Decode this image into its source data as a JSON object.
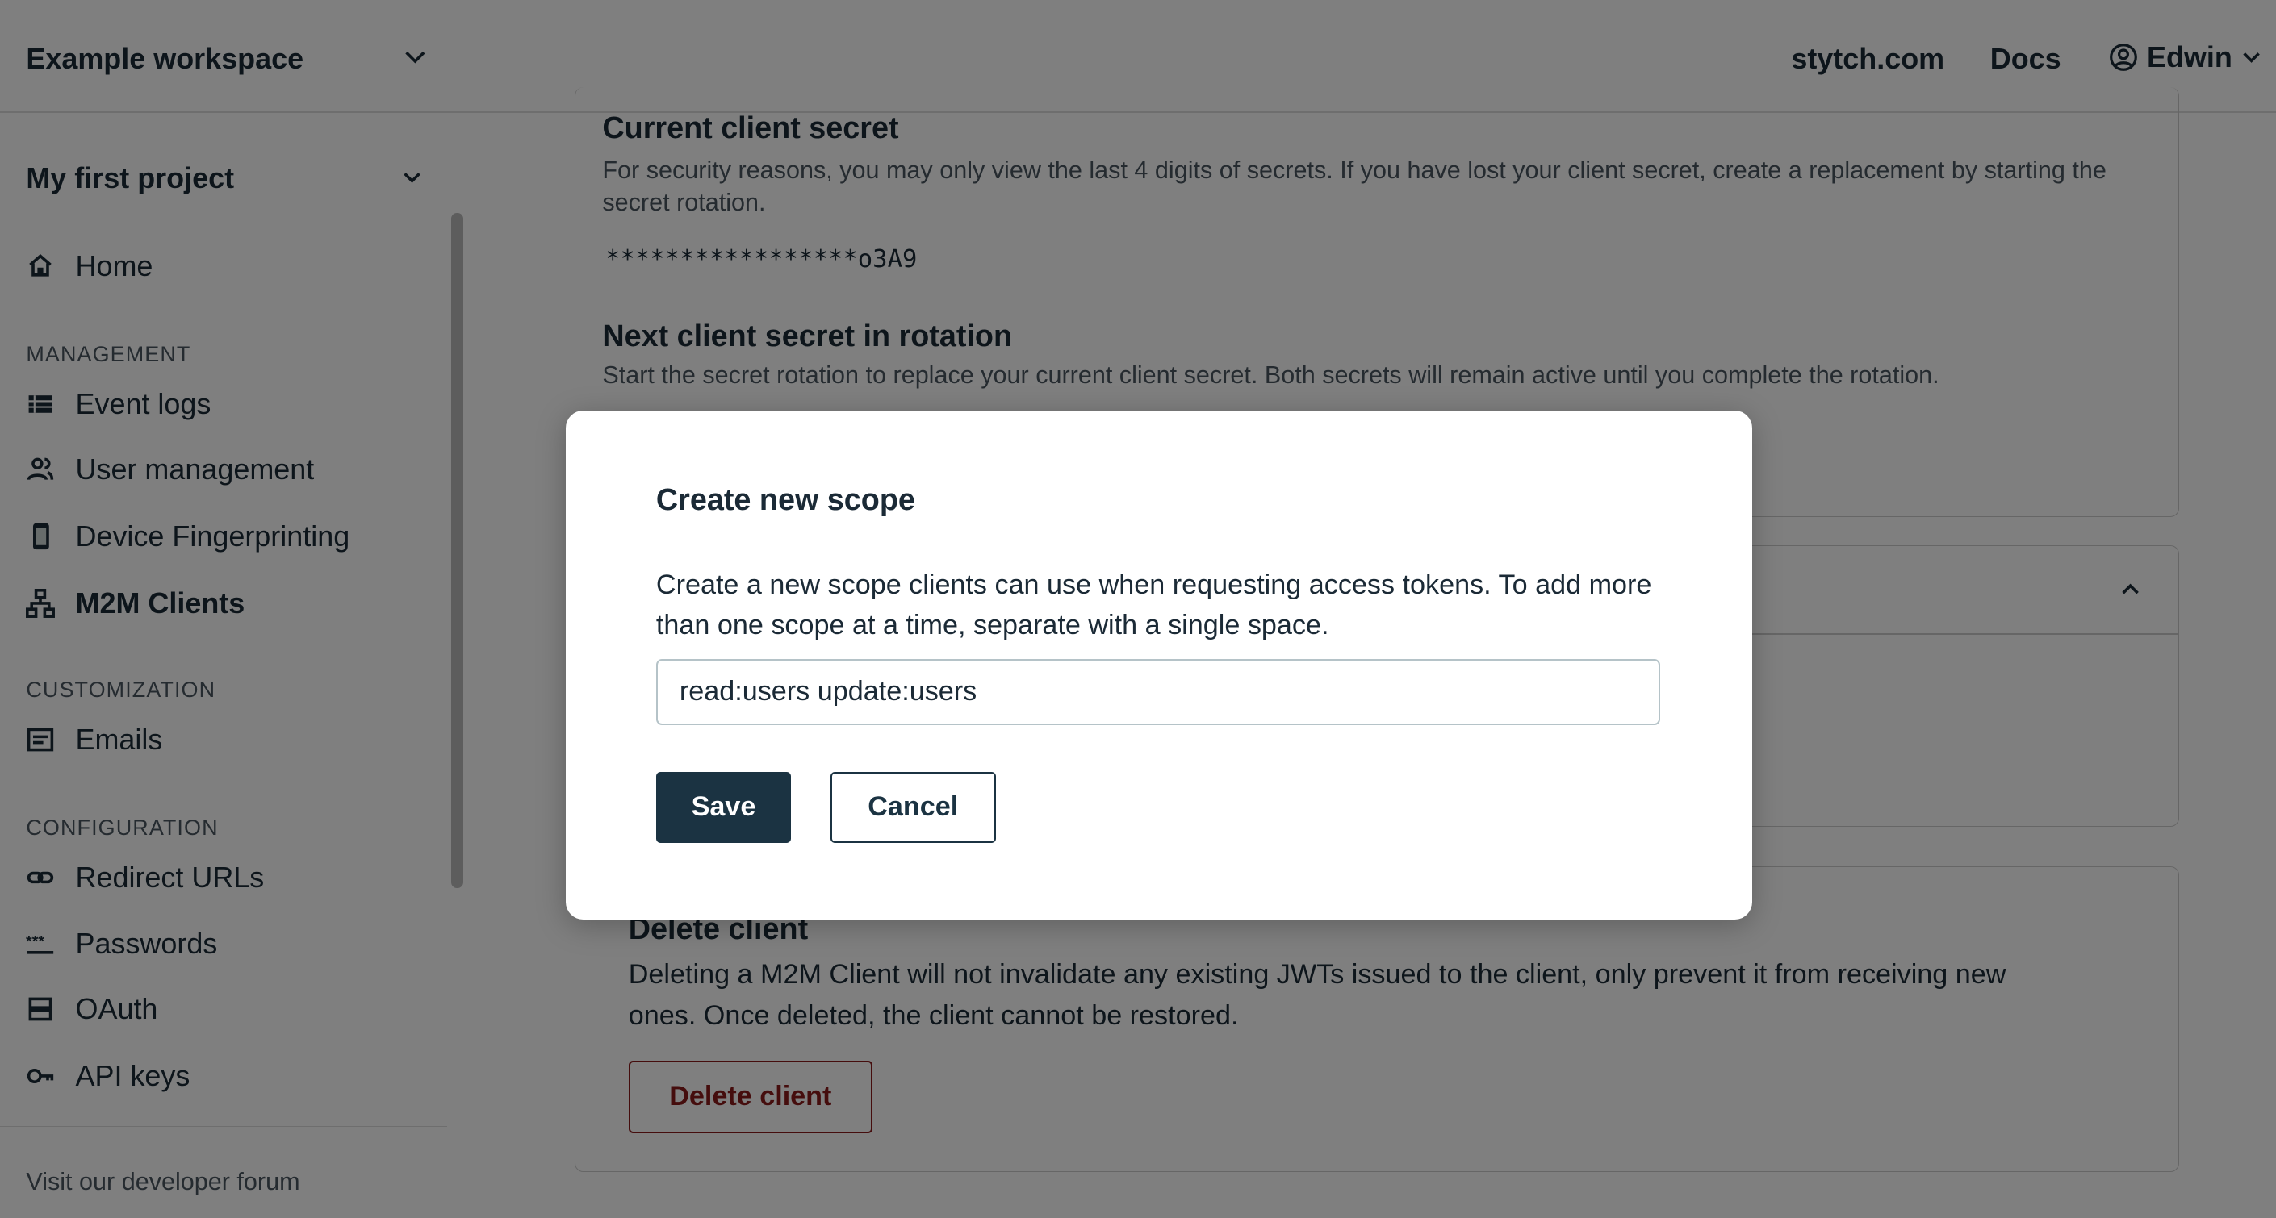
{
  "sidebar": {
    "workspace": "Example workspace",
    "project": "My first project",
    "home": "Home",
    "sections": {
      "management": "MANAGEMENT",
      "customization": "CUSTOMIZATION",
      "configuration": "CONFIGURATION"
    },
    "items": [
      {
        "label": "Event logs",
        "icon": "list-icon"
      },
      {
        "label": "User management",
        "icon": "users-icon"
      },
      {
        "label": "Device Fingerprinting",
        "icon": "fingerprint-device-icon"
      },
      {
        "label": "M2M Clients",
        "icon": "hierarchy-icon",
        "active": true
      },
      {
        "label": "Emails",
        "icon": "email-template-icon"
      },
      {
        "label": "Redirect URLs",
        "icon": "link-icon"
      },
      {
        "label": "Passwords",
        "icon": "password-icon"
      },
      {
        "label": "OAuth",
        "icon": "server-icon"
      },
      {
        "label": "API keys",
        "icon": "key-icon"
      }
    ],
    "forum": "Visit our developer forum"
  },
  "header": {
    "links": [
      "stytch.com",
      "Docs"
    ],
    "user": "Edwin"
  },
  "main": {
    "current_secret": {
      "title": "Current client secret",
      "desc": "For security reasons, you may only view the last 4 digits of secrets. If you have lost your client secret, create a replacement by starting the secret rotation.",
      "value": "*****************o3A9"
    },
    "next_secret": {
      "title": "Next client secret in rotation",
      "desc": "Start the secret rotation to replace your current client secret. Both secrets will remain active until you complete the rotation."
    },
    "delete": {
      "title": "Delete client",
      "desc": "Deleting a M2M Client will not invalidate any existing JWTs issued to the client, only prevent it from receiving new ones. Once deleted, the client cannot be restored.",
      "button": "Delete client"
    }
  },
  "modal": {
    "title": "Create new scope",
    "desc": "Create a new scope clients can use when requesting access tokens. To add more than one scope at a time, separate with a single space.",
    "input_value": "read:users update:users",
    "save": "Save",
    "cancel": "Cancel"
  },
  "colors": {
    "primary": "#1b3342",
    "danger": "#8b1a1a",
    "overlay": "rgba(0,0,0,0.5)"
  }
}
